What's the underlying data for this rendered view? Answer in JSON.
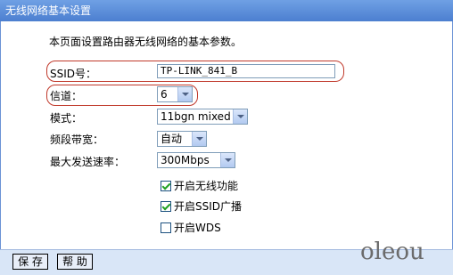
{
  "title": "无线网络基本设置",
  "description": "本页面设置路由器无线网络的基本参数。",
  "fields": {
    "ssid": {
      "label": "SSID号：",
      "value": "TP-LINK_841_B"
    },
    "channel": {
      "label": "信道：",
      "value": "6"
    },
    "mode": {
      "label": "模式：",
      "value": "11bgn mixed"
    },
    "bandwidth": {
      "label": "频段带宽：",
      "value": "自动"
    },
    "max_rate": {
      "label": "最大发送速率：",
      "value": "300Mbps"
    }
  },
  "checkboxes": [
    {
      "label": "开启无线功能",
      "checked": true
    },
    {
      "label": "开启SSID广播",
      "checked": true
    },
    {
      "label": "开启WDS",
      "checked": false
    }
  ],
  "buttons": {
    "save": "保 存",
    "help": "帮 助"
  },
  "watermark": "oleou",
  "colors": {
    "titlebar": "#4c7fd0",
    "footer": "#d9e6f7",
    "highlight": "#c0392b"
  }
}
